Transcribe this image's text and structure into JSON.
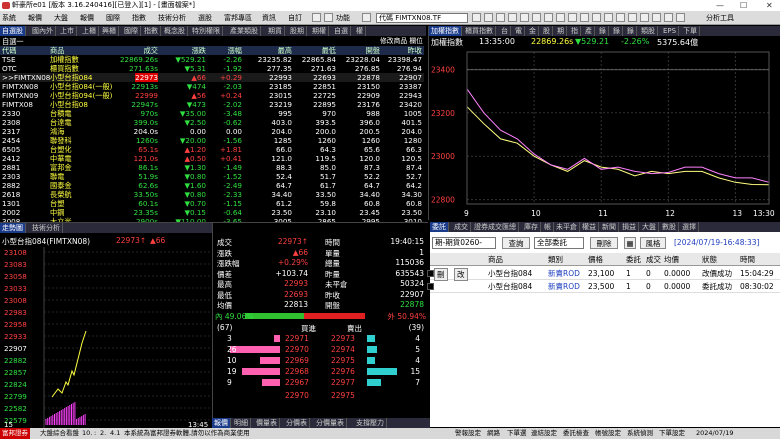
{
  "window": {
    "title": "軒豪所e01 [版本 3.16.240416][已登入][1] - [畫面檔案*]"
  },
  "menu": {
    "items": [
      "系統",
      "報價",
      "大盤",
      "報價",
      "國際",
      "指數",
      "技術分析",
      "選股",
      "富邦專區",
      "資訊",
      "自訂",
      "功能"
    ],
    "symbol": "代碼 FIMTXN08.TF",
    "analysis": "分析工具"
  },
  "quote_list": {
    "tabs": [
      "自選股",
      "國內外",
      "上市",
      "上櫃",
      "興櫃",
      "國際",
      "指數",
      "概念股",
      "特別權限",
      "產業類股",
      "期貨",
      "股期",
      "期權",
      "自選",
      "權"
    ],
    "group": "自選一",
    "right_label": "修改商品 欄位",
    "columns": [
      "代碼",
      "商品",
      "成交",
      "漲跌",
      "漲幅",
      "最高",
      "最低",
      "開盤",
      "昨收"
    ],
    "rows": [
      [
        "TSE",
        "加權指數",
        "22869.26s",
        "▼529.21",
        "-2.26",
        "23235.82",
        "22865.84",
        "23228.04",
        "23398.47"
      ],
      [
        "OTC",
        "櫃買指數",
        "271.63s",
        "▼5.31",
        "-1.92",
        "277.35",
        "271.63",
        "276.85",
        "276.94"
      ],
      [
        ">>FIMTXN08",
        "小型台指084",
        "22973",
        "▲66",
        "+0.29",
        "22993",
        "22693",
        "22878",
        "22907"
      ],
      [
        "FIMTXN08",
        "小型台指084(一般)",
        "22913s",
        "▼474",
        "-2.03",
        "23185",
        "22851",
        "23150",
        "23387"
      ],
      [
        "FIMTXN09",
        "小型台指094(一般)",
        "22999",
        "▲56",
        "+0.24",
        "23015",
        "22725",
        "22909",
        "22943"
      ],
      [
        "FIMTX08",
        "小型台指08",
        "22947s",
        "▼473",
        "-2.02",
        "23219",
        "22895",
        "23176",
        "23420"
      ],
      [
        "2330",
        "台積電",
        "970s",
        "▼35.00",
        "-3.48",
        "995",
        "970",
        "988",
        "1005"
      ],
      [
        "2308",
        "台達電",
        "399.0s",
        "▼2.50",
        "-0.62",
        "403.0",
        "393.5",
        "396.0",
        "401.5"
      ],
      [
        "2317",
        "鴻海",
        "204.0s",
        "0.00",
        "0.00",
        "204.0",
        "200.0",
        "200.5",
        "204.0"
      ],
      [
        "2454",
        "聯發科",
        "1260s",
        "▼20.00",
        "-1.56",
        "1285",
        "1260",
        "1260",
        "1280"
      ],
      [
        "6505",
        "台塑化",
        "65.1s",
        "▲1.20",
        "+1.81",
        "66.0",
        "64.3",
        "65.6",
        "66.3"
      ],
      [
        "2412",
        "中華電",
        "121.0s",
        "▲0.50",
        "+0.41",
        "121.0",
        "119.5",
        "120.0",
        "120.5"
      ],
      [
        "2881",
        "富邦金",
        "86.1s",
        "▼1.30",
        "-1.49",
        "88.3",
        "85.0",
        "87.3",
        "87.4"
      ],
      [
        "2303",
        "聯電",
        "51.9s",
        "▼0.80",
        "-1.52",
        "52.4",
        "51.7",
        "52.2",
        "52.7"
      ],
      [
        "2882",
        "國泰金",
        "62.6s",
        "▼1.60",
        "-2.49",
        "64.7",
        "61.7",
        "64.7",
        "64.2"
      ],
      [
        "2618",
        "長榮航",
        "33.50s",
        "▼0.80",
        "-2.33",
        "34.40",
        "33.50",
        "34.40",
        "34.30"
      ],
      [
        "1301",
        "台塑",
        "60.1s",
        "▼0.70",
        "-1.15",
        "61.2",
        "59.8",
        "60.8",
        "60.8"
      ],
      [
        "2002",
        "中鋼",
        "23.35s",
        "▼0.15",
        "-0.64",
        "23.50",
        "23.10",
        "23.45",
        "23.50"
      ],
      [
        "3008",
        "大立光",
        "2900s",
        "▼110.00",
        "-3.65",
        "3005",
        "2865",
        "2995",
        "3010"
      ]
    ]
  },
  "index_chart": {
    "tabs": [
      "加權指數",
      "櫃買指數",
      "台",
      "電",
      "金",
      "股",
      "期",
      "指",
      "產",
      "錄",
      "錄",
      "錄",
      "類股",
      "EPS",
      "下單"
    ],
    "name": "加權指數",
    "time": "13:35:00",
    "price": "22869.26s",
    "change": "▼529.21",
    "pct": "-2.26%",
    "volume": "5375.64億",
    "y_ticks": [
      "23400",
      "23200",
      "23000",
      "22800"
    ],
    "x_ticks": [
      "9",
      "10",
      "11",
      "12",
      "13",
      "13:30"
    ]
  },
  "chart_data": {
    "type": "line",
    "title": "加權指數",
    "x": [
      9,
      9.25,
      9.5,
      9.75,
      10,
      10.25,
      10.5,
      10.75,
      11,
      11.25,
      11.5,
      11.75,
      12,
      12.25,
      12.5,
      12.75,
      13,
      13.25,
      13.5
    ],
    "series": [
      {
        "values": [
          23228,
          23150,
          23080,
          23060,
          23000,
          22960,
          22930,
          22980,
          22950,
          22940,
          22910,
          22930,
          22920,
          22930,
          22930,
          22900,
          22880,
          22870,
          22869
        ]
      },
      {
        "values": [
          23310,
          23200,
          23120,
          23080,
          23010,
          22960,
          22940,
          22990,
          22940,
          22950,
          22930,
          22920,
          22925,
          22950,
          22950,
          22920,
          22900,
          22900,
          22880
        ]
      }
    ],
    "xlim": [
      9,
      13.5
    ],
    "ylim": [
      22780,
      23480
    ]
  },
  "small_chart": {
    "tabs": [
      "走勢圖",
      "技術分析"
    ],
    "title": "小型台指084(FIMTXN08)",
    "price": "22973↑",
    "chg": "▲66",
    "y_ticks": [
      "23108",
      "23083",
      "23058",
      "23033",
      "23008",
      "22983",
      "22958",
      "22933",
      "22907",
      "22882",
      "22857",
      "22824",
      "22799",
      "22582",
      "22579"
    ],
    "right_ticks": [
      "22907",
      "22882",
      "22857",
      "22824"
    ],
    "x_ticks": [
      "15",
      "18",
      "21",
      "24",
      "3",
      "6",
      "9",
      "12",
      "15"
    ],
    "footer_left": "15",
    "footer_right": "13:45"
  },
  "quote_detail": {
    "time": "19:40:15",
    "lines": [
      [
        "成交",
        "22973↑",
        "時間",
        "19:40:15"
      ],
      [
        "漲跌",
        "▲66",
        "單量",
        "1"
      ],
      [
        "漲跌幅",
        "+0.29%",
        "總量",
        "115036"
      ],
      [
        "價差",
        "+103.74",
        "昨量",
        "635543"
      ],
      [
        "最高",
        "22993",
        "未平倉",
        "50324"
      ],
      [
        "最低",
        "22693",
        "昨收",
        "22907"
      ],
      [
        "均價",
        "22813",
        "開盤",
        "22878"
      ]
    ],
    "inner_pct": "內 49.06%",
    "outer_pct": "外 50.94%",
    "bid_total": "(67)",
    "ask_total": "(39)",
    "bid_label": "買進",
    "ask_label": "賣出",
    "book": [
      [
        "3",
        "22971",
        "22973",
        "4"
      ],
      [
        "26",
        "22970",
        "22974",
        "5"
      ],
      [
        "10",
        "22969",
        "22975",
        "4"
      ],
      [
        "19",
        "22968",
        "22976",
        "15"
      ],
      [
        "9",
        "22967",
        "22977",
        "7"
      ]
    ],
    "sum": [
      "22970",
      "22975"
    ]
  },
  "orders": {
    "tabs": [
      "委託",
      "成交",
      "證券成交匯總",
      "庫存",
      "帳",
      "未平倉",
      "權益",
      "新聞",
      "損益",
      "大盤",
      "數股",
      "選擇"
    ],
    "account": "期-期貨0260-",
    "query": "查詢",
    "all": "全部委託",
    "delete": "刪除",
    "risk": "風格",
    "timestamp": "[2024/07/19-16:48:33]",
    "columns": [
      "",
      "",
      "商品",
      "類別",
      "價格",
      "委託",
      "成交",
      "均價",
      "狀態",
      "時間"
    ],
    "rows": [
      [
        "刪",
        "改",
        "小型台指084",
        "新賣ROD",
        "23,100",
        "1",
        "0",
        "0.0000",
        "改價成功",
        "15:04:29"
      ],
      [
        "",
        "",
        "小型台指084",
        "新賣ROD",
        "23,500",
        "1",
        "0",
        "0.0000",
        "委託成功",
        "08:30:02"
      ]
    ]
  },
  "bottom_tabs": [
    "報價",
    "明細",
    "價量表",
    "分價表",
    "分價量表",
    "支撐壓力"
  ],
  "status": {
    "items": [
      "富邦證券",
      "大盤綜合看盤",
      "10.",
      ":",
      "2.",
      "4.1",
      "本系統為富邦證券軟體,請勿以作為商業使用",
      "警報設定",
      "網路",
      "下單選",
      "連結設定",
      "委託檢查",
      "帳號設定",
      "系統偵測",
      "下單設定",
      "2024/07/19"
    ]
  }
}
